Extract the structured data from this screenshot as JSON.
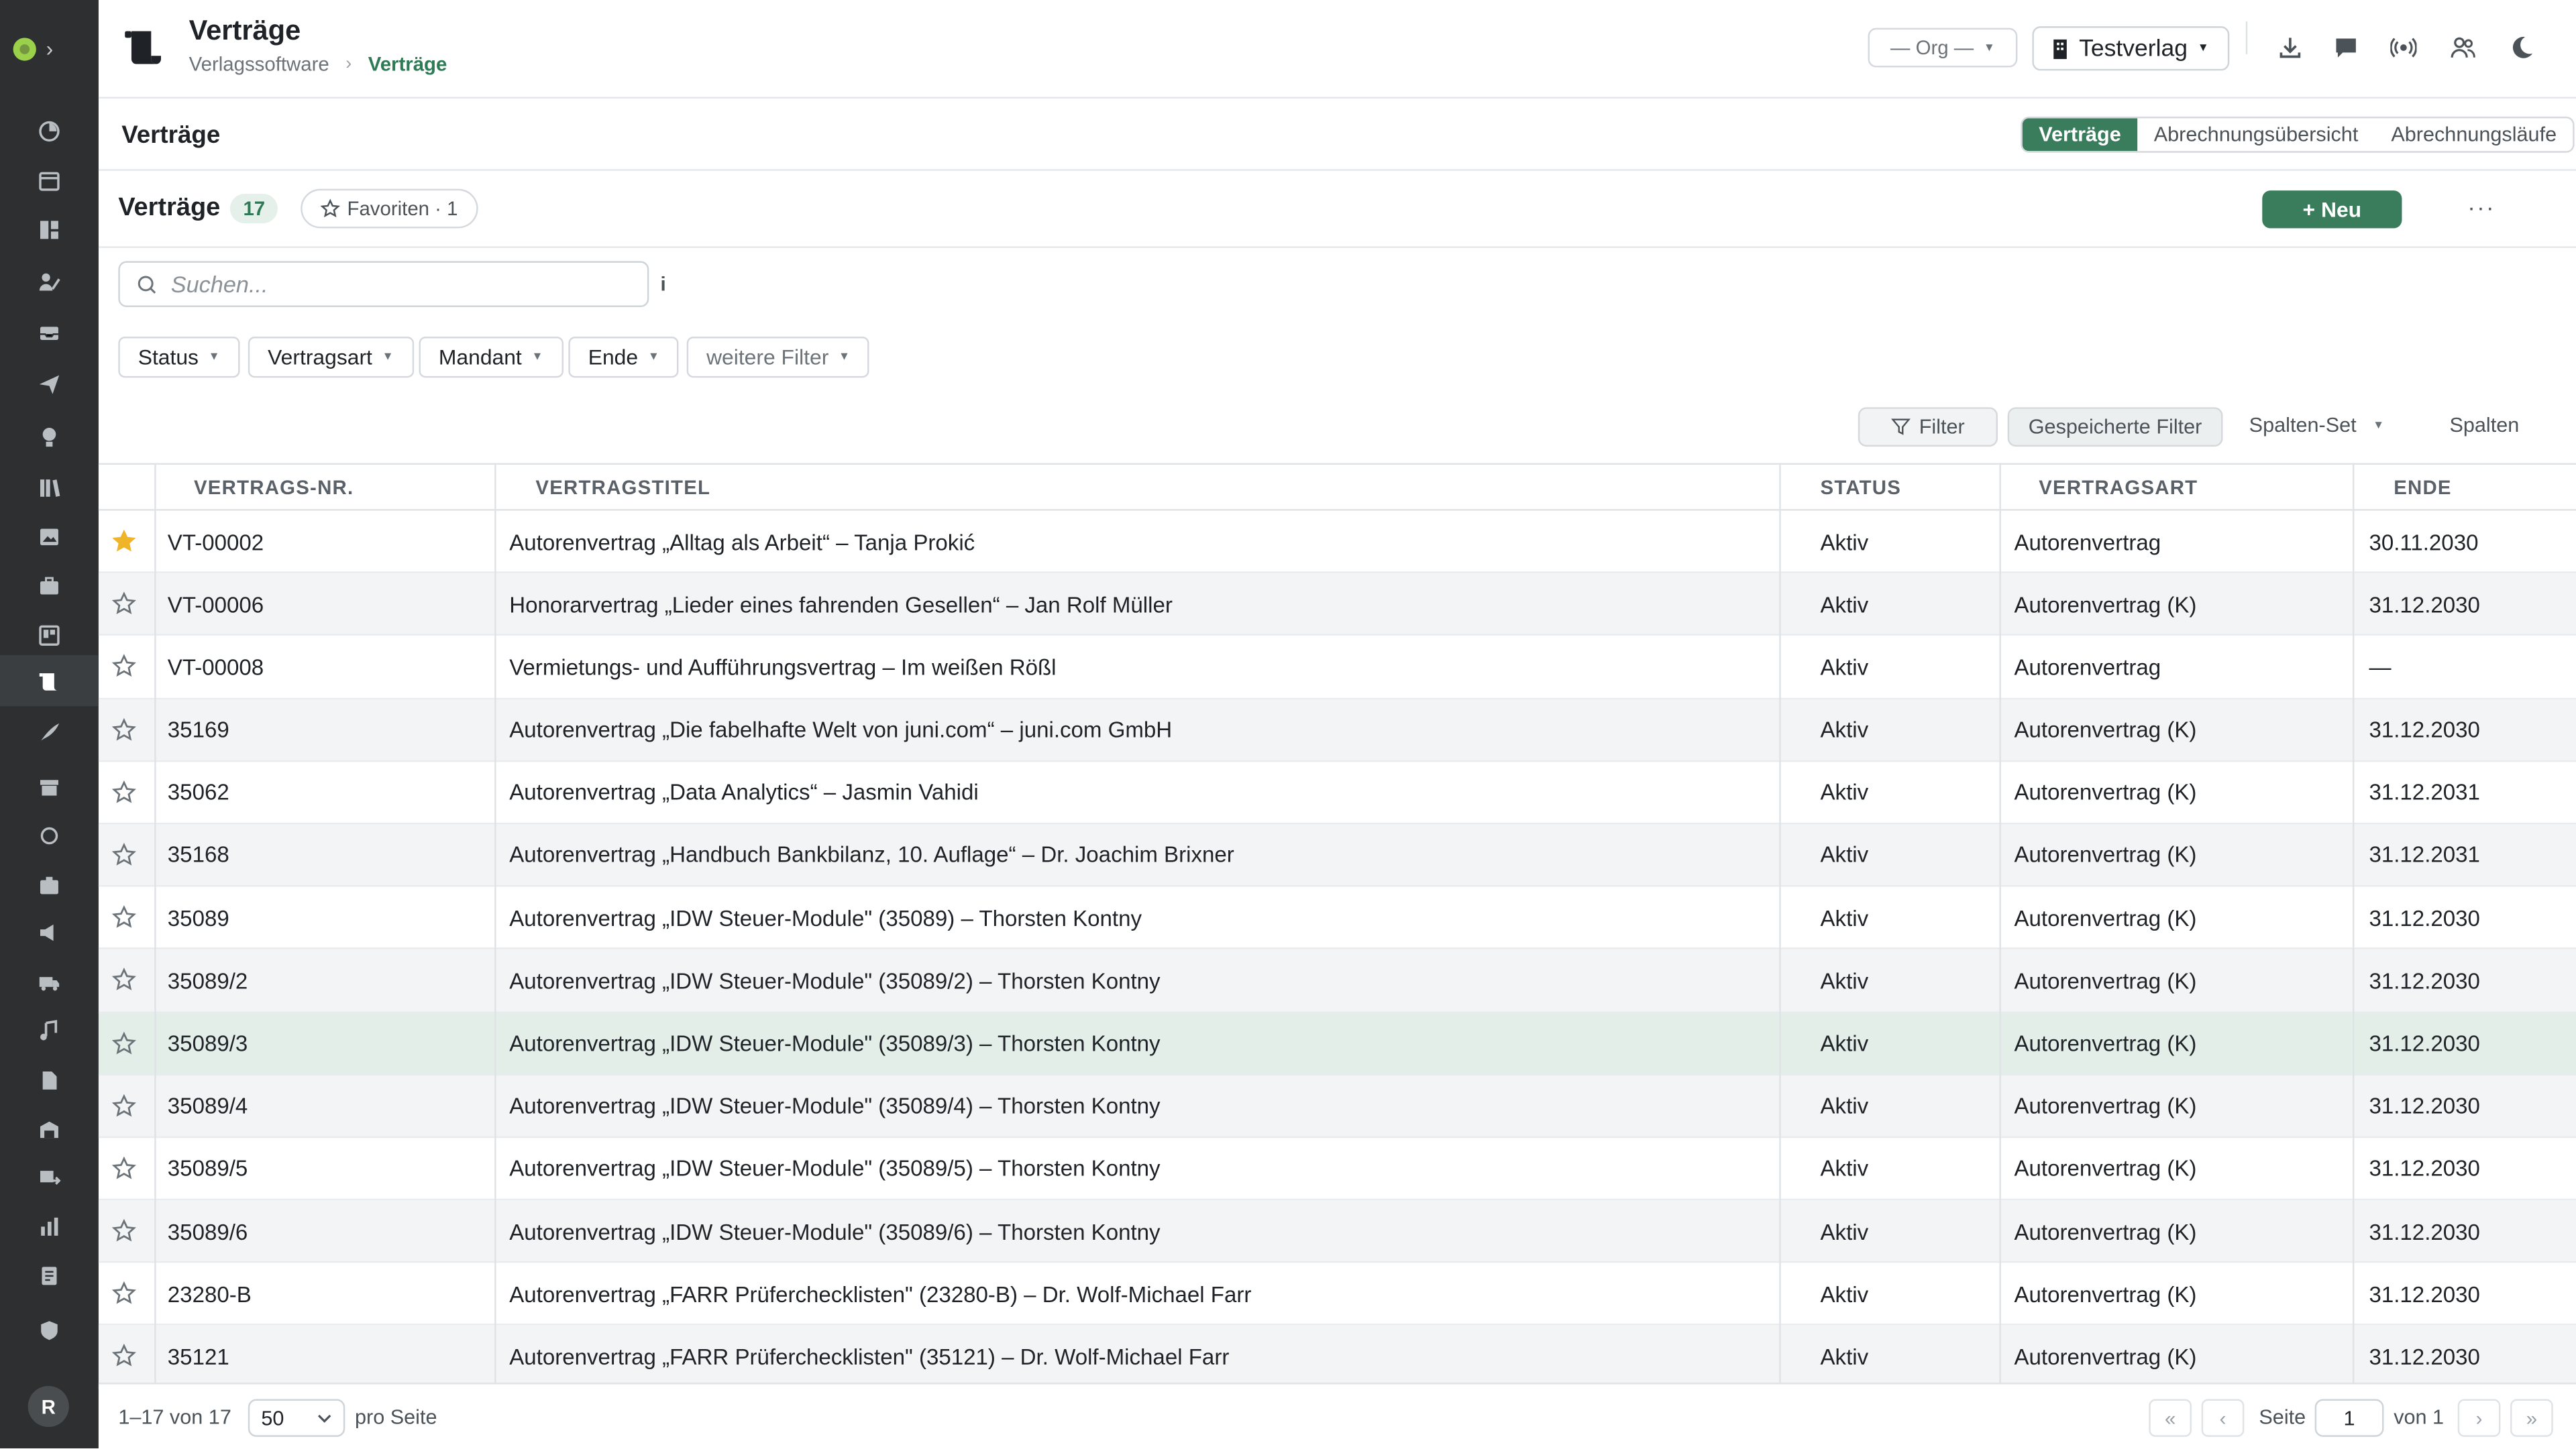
{
  "header": {
    "title": "Verträge",
    "breadcrumbs": [
      "Verlagssoftware",
      "Verträge"
    ],
    "org_select": "— Org —",
    "verlag_select": "Testverlag"
  },
  "subheader": {
    "title": "Verträge",
    "tabs": [
      {
        "label": "Verträge",
        "active": true
      },
      {
        "label": "Abrechnungsübersicht",
        "active": false
      },
      {
        "label": "Abrechnungsläufe",
        "active": false
      }
    ]
  },
  "toolbar": {
    "title": "Verträge",
    "count": "17",
    "favorites_label": "Favoriten · 1",
    "new_label": "+ Neu",
    "more_label": "···"
  },
  "search": {
    "placeholder": "Suchen...",
    "value": "",
    "info": "i"
  },
  "filters": [
    "Status",
    "Vertragsart",
    "Mandant",
    "Ende",
    "weitere Filter"
  ],
  "table_actions": {
    "filter_label": "Filter",
    "saved_filters_label": "Gespeicherte Filter",
    "column_set_label": "Spalten-Set",
    "columns_label": "Spalten"
  },
  "table": {
    "columns": [
      "VERTRAGS-NR.",
      "VERTRAGSTITEL",
      "STATUS",
      "VERTRAGSART",
      "ENDE"
    ],
    "rows": [
      {
        "favorite": true,
        "nr": "VT-00002",
        "title": "Autorenvertrag „Alltag als Arbeit“ – Tanja Prokić",
        "status": "Aktiv",
        "type": "Autorenvertrag",
        "end": "30.11.2030"
      },
      {
        "favorite": false,
        "nr": "VT-00006",
        "title": "Honorarvertrag „Lieder eines fahrenden Gesellen“ – Jan Rolf Müller",
        "status": "Aktiv",
        "type": "Autorenvertrag (K)",
        "end": "31.12.2030"
      },
      {
        "favorite": false,
        "nr": "VT-00008",
        "title": "Vermietungs- und Aufführungsvertrag – Im weißen Rößl",
        "status": "Aktiv",
        "type": "Autorenvertrag",
        "end": "—"
      },
      {
        "favorite": false,
        "nr": "35169",
        "title": "Autorenvertrag „Die fabelhafte Welt von juni.com“ – juni.com GmbH",
        "status": "Aktiv",
        "type": "Autorenvertrag (K)",
        "end": "31.12.2030"
      },
      {
        "favorite": false,
        "nr": "35062",
        "title": "Autorenvertrag „Data Analytics“ – Jasmin Vahidi",
        "status": "Aktiv",
        "type": "Autorenvertrag (K)",
        "end": "31.12.2031"
      },
      {
        "favorite": false,
        "nr": "35168",
        "title": "Autorenvertrag „Handbuch Bankbilanz, 10. Auflage“ – Dr. Joachim Brixner",
        "status": "Aktiv",
        "type": "Autorenvertrag (K)",
        "end": "31.12.2031"
      },
      {
        "favorite": false,
        "nr": "35089",
        "title": "Autorenvertrag „IDW Steuer-Module\" (35089) – Thorsten Kontny",
        "status": "Aktiv",
        "type": "Autorenvertrag (K)",
        "end": "31.12.2030"
      },
      {
        "favorite": false,
        "nr": "35089/2",
        "title": "Autorenvertrag „IDW Steuer-Module\" (35089/2) – Thorsten Kontny",
        "status": "Aktiv",
        "type": "Autorenvertrag (K)",
        "end": "31.12.2030"
      },
      {
        "favorite": false,
        "nr": "35089/3",
        "title": "Autorenvertrag „IDW Steuer-Module\" (35089/3) – Thorsten Kontny",
        "status": "Aktiv",
        "type": "Autorenvertrag (K)",
        "end": "31.12.2030"
      },
      {
        "favorite": false,
        "nr": "35089/4",
        "title": "Autorenvertrag „IDW Steuer-Module\" (35089/4) – Thorsten Kontny",
        "status": "Aktiv",
        "type": "Autorenvertrag (K)",
        "end": "31.12.2030"
      },
      {
        "favorite": false,
        "nr": "35089/5",
        "title": "Autorenvertrag „IDW Steuer-Module\" (35089/5) – Thorsten Kontny",
        "status": "Aktiv",
        "type": "Autorenvertrag (K)",
        "end": "31.12.2030"
      },
      {
        "favorite": false,
        "nr": "35089/6",
        "title": "Autorenvertrag „IDW Steuer-Module\" (35089/6) – Thorsten Kontny",
        "status": "Aktiv",
        "type": "Autorenvertrag (K)",
        "end": "31.12.2030"
      },
      {
        "favorite": false,
        "nr": "23280-B",
        "title": "Autorenvertrag „FARR Prüferchecklisten\" (23280-B) – Dr. Wolf-Michael Farr",
        "status": "Aktiv",
        "type": "Autorenvertrag (K)",
        "end": "31.12.2030"
      },
      {
        "favorite": false,
        "nr": "35121",
        "title": "Autorenvertrag „FARR Prüferchecklisten\" (35121) – Dr. Wolf-Michael Farr",
        "status": "Aktiv",
        "type": "Autorenvertrag (K)",
        "end": "31.12.2030"
      }
    ]
  },
  "footer": {
    "range": "1–17 von 17",
    "per_page_value": "50",
    "per_page_label": "pro Seite",
    "page_label": "Seite",
    "page_value": "1",
    "of_label": "von 1"
  },
  "user": {
    "avatar_initial": "R"
  },
  "colors": {
    "accent": "#3a7d5c",
    "sidebar": "#2d2f31",
    "favorite": "#f0b429"
  }
}
